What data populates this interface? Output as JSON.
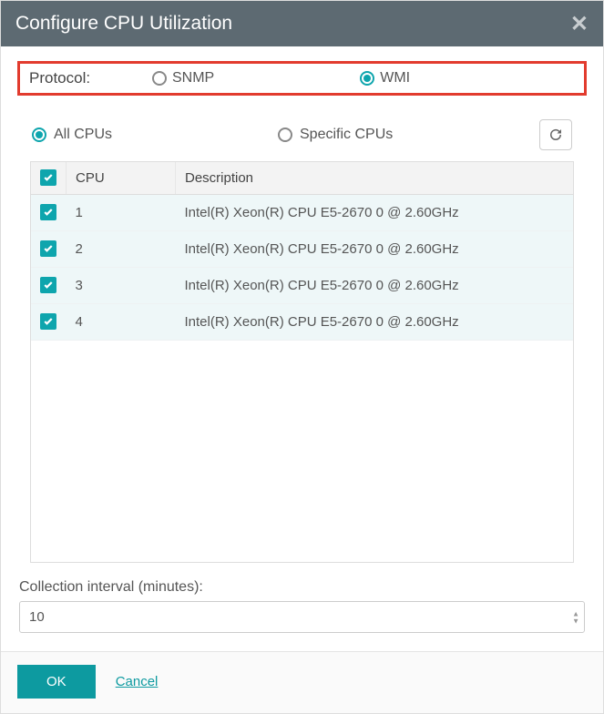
{
  "dialog": {
    "title": "Configure CPU Utilization"
  },
  "protocol": {
    "label": "Protocol:",
    "options": {
      "snmp": "SNMP",
      "wmi": "WMI"
    },
    "selected": "wmi"
  },
  "cpu_mode": {
    "all": "All CPUs",
    "specific": "Specific CPUs",
    "selected": "all"
  },
  "table": {
    "headers": {
      "cpu": "CPU",
      "description": "Description"
    },
    "rows": [
      {
        "checked": true,
        "cpu": "1",
        "description": "Intel(R) Xeon(R) CPU E5-2670 0 @ 2.60GHz"
      },
      {
        "checked": true,
        "cpu": "2",
        "description": "Intel(R) Xeon(R) CPU E5-2670 0 @ 2.60GHz"
      },
      {
        "checked": true,
        "cpu": "3",
        "description": "Intel(R) Xeon(R) CPU E5-2670 0 @ 2.60GHz"
      },
      {
        "checked": true,
        "cpu": "4",
        "description": "Intel(R) Xeon(R) CPU E5-2670 0 @ 2.60GHz"
      }
    ]
  },
  "interval": {
    "label": "Collection interval (minutes):",
    "value": "10"
  },
  "footer": {
    "ok": "OK",
    "cancel": "Cancel"
  }
}
